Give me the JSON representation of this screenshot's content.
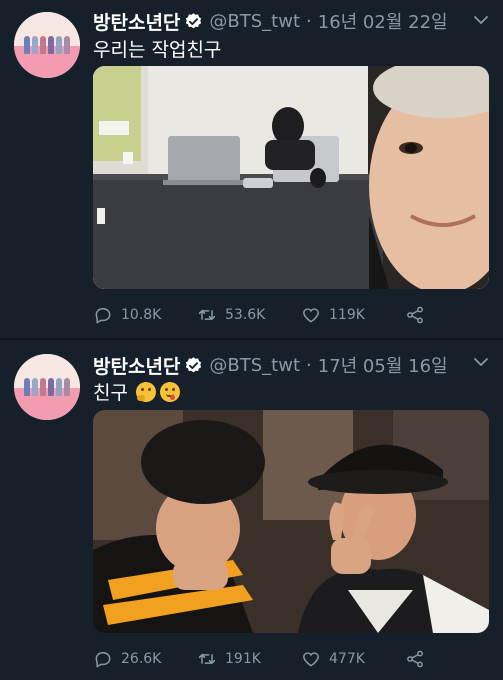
{
  "tweets": [
    {
      "display_name": "방탄소년단",
      "handle": "@BTS_twt",
      "separator": "·",
      "date": "16년 02월 22일",
      "text": "우리는 작업친구",
      "emojis": [],
      "stats": {
        "replies": "10.8K",
        "retweets": "53.6K",
        "likes": "119K"
      }
    },
    {
      "display_name": "방탄소년단",
      "handle": "@BTS_twt",
      "separator": "·",
      "date": "17년 05월 16일",
      "text": "친구",
      "emojis": [
        "thinking-face-emoji",
        "face-savoring-food-emoji"
      ],
      "stats": {
        "replies": "26.6K",
        "retweets": "191K",
        "likes": "477K"
      }
    }
  ],
  "colors": {
    "background": "#15202b",
    "secondary_text": "#8899a6",
    "verified_badge": "#ffffff"
  }
}
